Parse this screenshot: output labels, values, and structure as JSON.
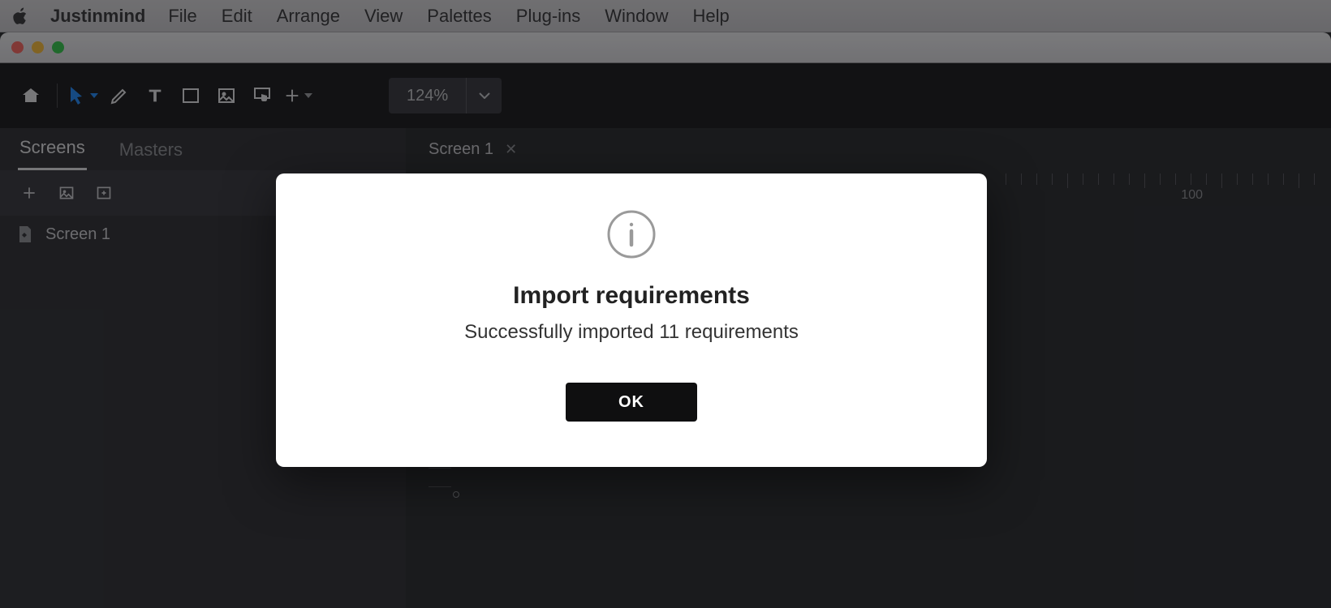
{
  "menubar": {
    "app_name": "Justinmind",
    "items": [
      "File",
      "Edit",
      "Arrange",
      "View",
      "Palettes",
      "Plug-ins",
      "Window",
      "Help"
    ]
  },
  "toolbar": {
    "zoom": "124%"
  },
  "side_panel": {
    "tabs": {
      "screens": "Screens",
      "masters": "Masters"
    },
    "screens": [
      {
        "name": "Screen 1"
      }
    ]
  },
  "document_tabs": [
    {
      "label": "Screen 1"
    }
  ],
  "ruler": {
    "label_100": "100"
  },
  "modal": {
    "title": "Import requirements",
    "message": "Successfully imported 11 requirements",
    "ok_label": "OK"
  }
}
